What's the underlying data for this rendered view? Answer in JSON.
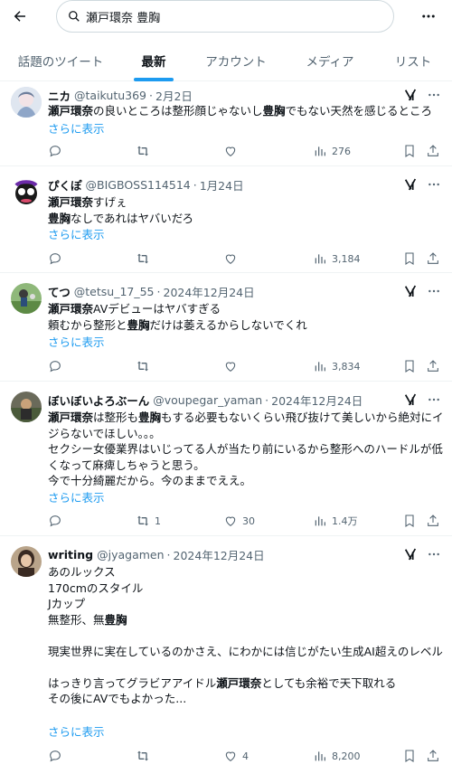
{
  "search": {
    "query": "瀬戸環奈 豊胸"
  },
  "tabs": [
    {
      "label": "話題のツイート"
    },
    {
      "label": "最新"
    },
    {
      "label": "アカウント"
    },
    {
      "label": "メディア"
    },
    {
      "label": "リスト"
    }
  ],
  "show_more": "さらに表示",
  "colors": {
    "accent": "#1d9bf0",
    "text": "#0f1419",
    "muted": "#536471"
  },
  "tweets": [
    {
      "name": "ニカ",
      "handle": "@taikutu369",
      "date": "2月2日",
      "body_parts": [
        {
          "t": "瀬戸環奈",
          "b": true
        },
        {
          "t": "の良いところは整形顔じゃないし"
        },
        {
          "t": "豊胸",
          "b": true
        },
        {
          "t": "でもない天然を感じるところ"
        }
      ],
      "replies": "",
      "retweets": "",
      "likes": "",
      "views": "276"
    },
    {
      "name": "ぴくぽ",
      "handle": "@BIGBOSS114514",
      "date": "1月24日",
      "body_parts": [
        {
          "t": "瀬戸環奈",
          "b": true
        },
        {
          "t": "すげぇ\n"
        },
        {
          "t": "豊胸",
          "b": true
        },
        {
          "t": "なしであれはヤバいだろ"
        }
      ],
      "replies": "",
      "retweets": "",
      "likes": "",
      "views": "3,184"
    },
    {
      "name": "てつ",
      "handle": "@tetsu_17_55",
      "date": "2024年12月24日",
      "body_parts": [
        {
          "t": "瀬戸環奈",
          "b": true
        },
        {
          "t": "AVデビューはヤバすぎる\n頼むから整形と"
        },
        {
          "t": "豊胸",
          "b": true
        },
        {
          "t": "だけは萎えるからしないでくれ"
        }
      ],
      "replies": "",
      "retweets": "",
      "likes": "",
      "views": "3,834"
    },
    {
      "name": "ぼいぼいよろぶーん",
      "handle": "@voupegar_yaman",
      "date": "2024年12月24日",
      "body_parts": [
        {
          "t": "瀬戸環奈",
          "b": true
        },
        {
          "t": "は整形も"
        },
        {
          "t": "豊胸",
          "b": true
        },
        {
          "t": "もする必要もないくらい飛び抜けて美しいから絶対にイジらないでほしい。。。\nセクシー女優業界はいじってる人が当たり前にいるから整形へのハードルが低くなって麻痺しちゃうと思う。\n今で十分綺麗だから。今のままでええ。"
        }
      ],
      "replies": "",
      "retweets": "1",
      "likes": "30",
      "views": "1.4万"
    },
    {
      "name": "writing",
      "handle": "@jyagamen",
      "date": "2024年12月24日",
      "body_parts": [
        {
          "t": "あのルックス\n170cmのスタイル\nJカップ\n無整形、無"
        },
        {
          "t": "豊胸",
          "b": true
        },
        {
          "t": "\n\n現実世界に実在しているのかさえ、にわかには信じがたい生成AI超えのレベル\n\nはっきり言ってグラビアアイドル"
        },
        {
          "t": "瀬戸環奈",
          "b": true
        },
        {
          "t": "としても余裕で天下取れる\nその後にAVでもよかった..."
        }
      ],
      "replies": "",
      "retweets": "",
      "likes": "4",
      "views": "8,200"
    }
  ]
}
